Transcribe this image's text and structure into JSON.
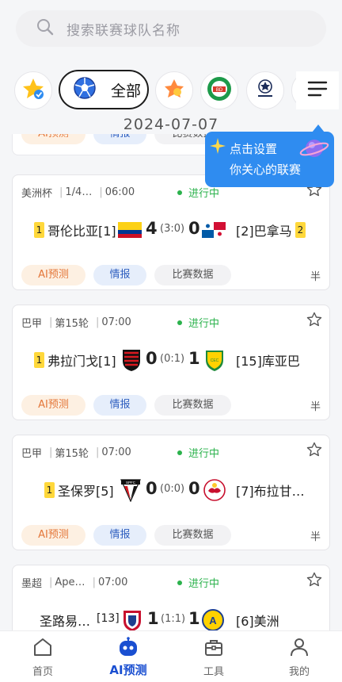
{
  "search": {
    "placeholder": "搜索联赛球队名称",
    "icon": "search-icon"
  },
  "chips": {
    "all_label": "全部"
  },
  "date": "2024-07-07",
  "peek": {
    "ai": "AI预测",
    "info": "情报",
    "data": "比赛数据"
  },
  "tooltip": {
    "line1": "点击设置",
    "line2": "你关心的联赛",
    "color": "#2f8cf0"
  },
  "matches": [
    {
      "league": "美洲杯",
      "round": "1/4…",
      "time": "06:00",
      "status": "进行中",
      "home_rank": "1",
      "home": "哥伦比亚[1]",
      "home_score": "4",
      "half": "(3:0)",
      "away_score": "0",
      "away": "[2]巴拿马",
      "away_rank": "2",
      "ai": "AI预测",
      "info": "情报",
      "data": "比赛数据",
      "half_label": "半"
    },
    {
      "league": "巴甲",
      "round": "第15轮",
      "time": "07:00",
      "status": "进行中",
      "home_rank": "1",
      "home": "弗拉门戈[1]",
      "home_score": "0",
      "half": "(0:1)",
      "away_score": "1",
      "away": "[15]库亚巴",
      "away_rank": "",
      "ai": "AI预测",
      "info": "情报",
      "data": "比赛数据",
      "half_label": "半"
    },
    {
      "league": "巴甲",
      "round": "第15轮",
      "time": "07:00",
      "status": "进行中",
      "home_rank": "1",
      "home": "圣保罗[5]",
      "home_score": "0",
      "half": "(0:0)",
      "away_score": "0",
      "away": "[7]布拉甘…",
      "away_rank": "",
      "ai": "AI预测",
      "info": "情报",
      "data": "比赛数据",
      "half_label": "半"
    },
    {
      "league": "墨超",
      "round": "Ape…",
      "time": "07:00",
      "status": "进行中",
      "home_rank": "",
      "home": "圣路易…",
      "home_seed": "[13]",
      "home_score": "1",
      "half": "(1:1)",
      "away_score": "1",
      "away": "[6]美洲",
      "away_rank": ""
    }
  ],
  "nav": [
    {
      "label": "首页",
      "icon": "home-icon"
    },
    {
      "label": "AI预测",
      "icon": "robot-icon",
      "active": true
    },
    {
      "label": "工具",
      "icon": "toolbox-icon"
    },
    {
      "label": "我的",
      "icon": "profile-icon"
    }
  ],
  "colors": {
    "live": "#2bb24c",
    "rank_badge": "#ffd83b",
    "active_nav": "#1a4fd1",
    "ai_tag": "#e4773a"
  }
}
